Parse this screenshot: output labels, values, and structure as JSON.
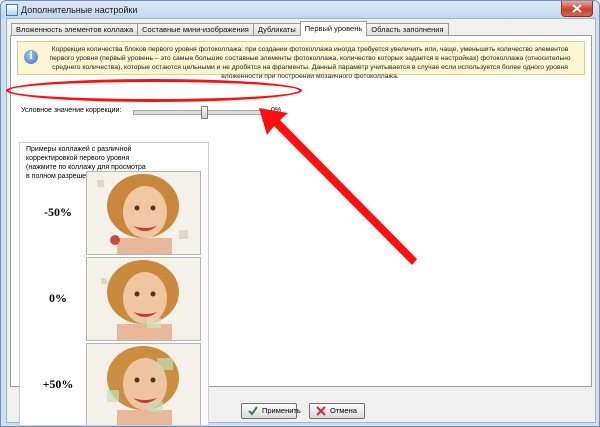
{
  "window": {
    "title": "Дополнительные настройки"
  },
  "tabs": [
    {
      "label": "Вложенность элементов коллажа"
    },
    {
      "label": "Составные мини-изображения"
    },
    {
      "label": "Дубликаты"
    },
    {
      "label": "Первый уровень"
    },
    {
      "label": "Область заполнения"
    }
  ],
  "info": {
    "text": "Коррекция количества блоков первого уровня фотоколлажа: при создании фотоколлажа иногда требуется увеличить или, чаще, уменьшить количество элементов первого уровня (первый уровень – это самые большие составные элементы фотоколлажа, количество которых задается в настройках) фотоколлажа (относительно среднего количества), которые остаются цельными и не дробятся на фрагменты. Данный параметр учитывается в случае если используется более одного уровня вложенности при построении мозаичного фотоколлажа."
  },
  "slider": {
    "label": "Условное значение коррекции:",
    "value_text": "0%",
    "position_fraction": 0.54
  },
  "examples": {
    "caption": "Примеры коллажей с различной корректировкой первого уровня (нажмите по коллажу для просмотра в полном разрешении).",
    "items": [
      {
        "label": "-50%"
      },
      {
        "label": "0%"
      },
      {
        "label": "+50%"
      }
    ]
  },
  "buttons": {
    "apply": "Применить",
    "cancel": "Отмена"
  },
  "colors": {
    "highlight": "#ff1010",
    "info_bg": "#fbf6cf"
  }
}
